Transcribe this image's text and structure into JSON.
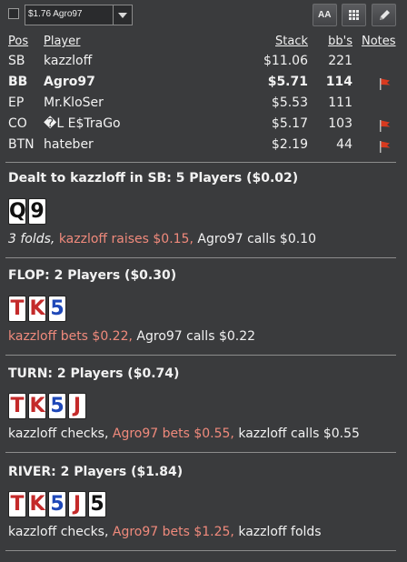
{
  "toolbar": {
    "table_select_value": "$1.76 Agro97",
    "aa_label": "AA",
    "grid_icon": "grid-icon",
    "edit_icon": "pencil-icon"
  },
  "players_header": {
    "pos": "Pos",
    "player": "Player",
    "stack": "Stack",
    "bbs": "bb's",
    "notes": "Notes"
  },
  "players": [
    {
      "pos": "SB",
      "player": "kazzloff",
      "stack": "$11.06",
      "bbs": "221",
      "flag": false,
      "bold": false
    },
    {
      "pos": "BB",
      "player": "Agro97",
      "stack": "$5.71",
      "bbs": "114",
      "flag": true,
      "bold": true
    },
    {
      "pos": "EP",
      "player": "Mr.KloSer",
      "stack": "$5.53",
      "bbs": "111",
      "flag": false,
      "bold": false
    },
    {
      "pos": "CO",
      "player": "�L E$TraGo",
      "stack": "$5.17",
      "bbs": "103",
      "flag": true,
      "bold": false
    },
    {
      "pos": "BTN",
      "player": "hateber",
      "stack": "$2.19",
      "bbs": "44",
      "flag": true,
      "bold": false
    }
  ],
  "preflop": {
    "header": "Dealt to kazzloff in SB: 5 Players ($0.02)",
    "cards": [
      {
        "rank": "Q",
        "color": "black"
      },
      {
        "rank": "9",
        "color": "black"
      }
    ],
    "folds": "3 folds,",
    "action1": " kazzloff raises $0.15,",
    "action2": " Agro97 calls $0.10"
  },
  "flop": {
    "header": "FLOP: 2 Players ($0.30)",
    "cards": [
      {
        "rank": "T",
        "color": "red"
      },
      {
        "rank": "K",
        "color": "red"
      },
      {
        "rank": "5",
        "color": "blue"
      }
    ],
    "action1": "kazzloff bets $0.22,",
    "action2": " Agro97 calls $0.22"
  },
  "turn": {
    "header": "TURN: 2 Players ($0.74)",
    "cards": [
      {
        "rank": "T",
        "color": "red"
      },
      {
        "rank": "K",
        "color": "red"
      },
      {
        "rank": "5",
        "color": "blue"
      },
      {
        "rank": "J",
        "color": "red"
      }
    ],
    "action1": "kazzloff checks,",
    "action2": " Agro97 bets $0.55,",
    "action3": " kazzloff calls $0.55"
  },
  "river": {
    "header": "RIVER: 2 Players ($1.84)",
    "cards": [
      {
        "rank": "T",
        "color": "red"
      },
      {
        "rank": "K",
        "color": "red"
      },
      {
        "rank": "5",
        "color": "blue"
      },
      {
        "rank": "J",
        "color": "red"
      },
      {
        "rank": "5",
        "color": "black"
      }
    ],
    "action1": "kazzloff checks,",
    "action2": " Agro97 bets $1.25,",
    "action3": " kazzloff folds"
  },
  "colors": {
    "background": "#3a3b3d",
    "highlight_action": "#f08a7c",
    "red_suit": "#c42a2a",
    "blue_suit": "#1f48b8",
    "flag_red": "#d93a1f"
  }
}
